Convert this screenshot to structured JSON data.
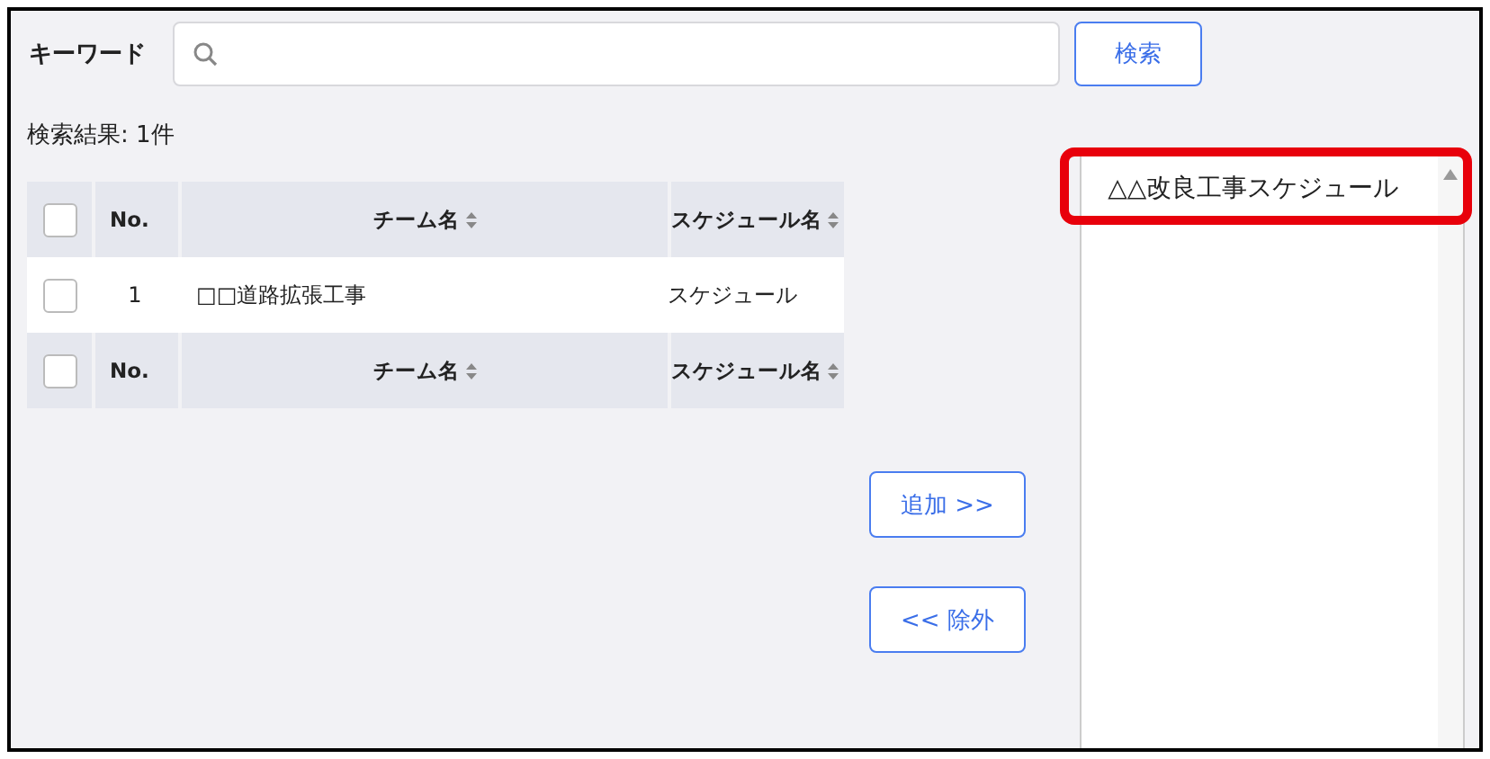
{
  "search": {
    "label": "キーワード",
    "button": "検索"
  },
  "result_count": "検索結果: 1件",
  "table": {
    "header": {
      "checked": false,
      "columns": [
        {
          "label": "No.",
          "sortable": false
        },
        {
          "label": "チーム名",
          "sortable": true
        },
        {
          "label": "スケジュール名",
          "sortable": true
        }
      ]
    },
    "rows": [
      {
        "checked": false,
        "cells": [
          "1",
          "□□道路拡張工事",
          "スケジュール"
        ]
      }
    ],
    "footer": {
      "checked": false,
      "columns": [
        {
          "label": "No.",
          "sortable": false
        },
        {
          "label": "チーム名",
          "sortable": true
        },
        {
          "label": "スケジュール名",
          "sortable": true
        }
      ]
    }
  },
  "transfer_buttons": [
    "追加 >>",
    "<< 除外"
  ],
  "selected_list": {
    "items": [
      {
        "label": "△△改良工事スケジュール",
        "highlighted": true
      }
    ]
  }
}
